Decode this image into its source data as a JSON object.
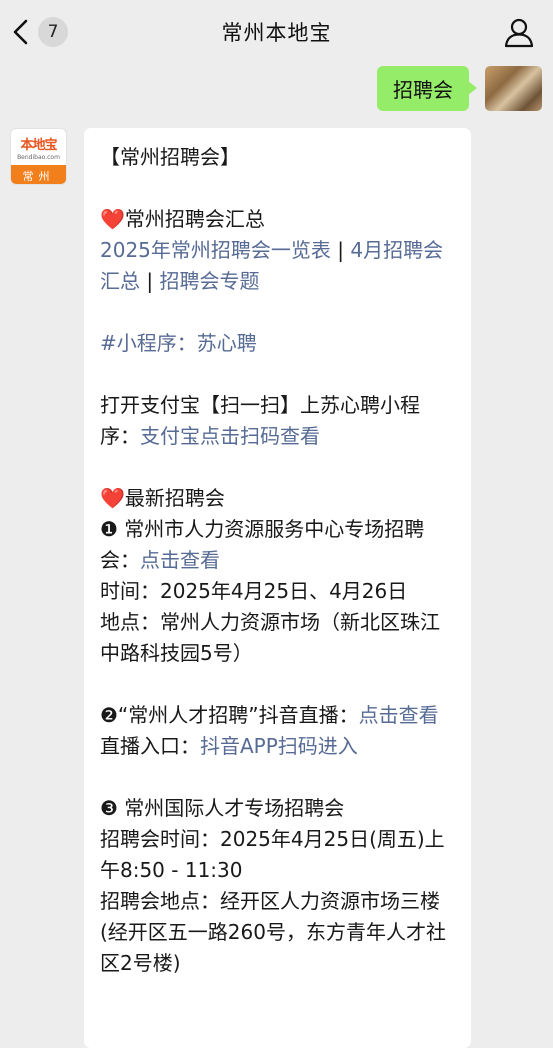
{
  "header": {
    "unread_count": "7",
    "title": "常州本地宝"
  },
  "outgoing": {
    "message": "招聘会"
  },
  "incoming_avatar": {
    "logo_main": "本地宝",
    "logo_sub": "Bendibao.com",
    "city": "常州"
  },
  "message": {
    "heading": "【常州招聘会】",
    "s1_title": "常州招聘会汇总",
    "s1_link1": "2025年常州招聘会一览表",
    "s1_sep1": " | ",
    "s1_link2": "4月招聘会汇总",
    "s1_sep2": " | ",
    "s1_link3": "招聘会专题",
    "mini_program": "#小程序：苏心聘",
    "alipay_text": "打开支付宝【扫一扫】上苏心聘小程序：",
    "alipay_link": "支付宝点击扫码查看",
    "s2_title": "最新招聘会",
    "i1_title": "❶ 常州市人力资源服务中心专场招聘会：",
    "i1_link": "点击查看",
    "i1_time": "时间：2025年4月25日、4月26日",
    "i1_place": "地点：常州人力资源市场（新北区珠江中路科技园5号）",
    "i2_title": "❷“常州人才招聘”抖音直播：",
    "i2_link": "点击查看",
    "i2_entry_label": "直播入口：",
    "i2_entry_link": "抖音APP扫码进入",
    "i3_title": "❸ 常州国际人才专场招聘会",
    "i3_time": "招聘会时间：2025年4月25日(周五)上午8:50 - 11:30",
    "i3_place": "招聘会地点：经开区人力资源市场三楼(经开区五一路260号，东方青年人才社区2号楼)"
  }
}
